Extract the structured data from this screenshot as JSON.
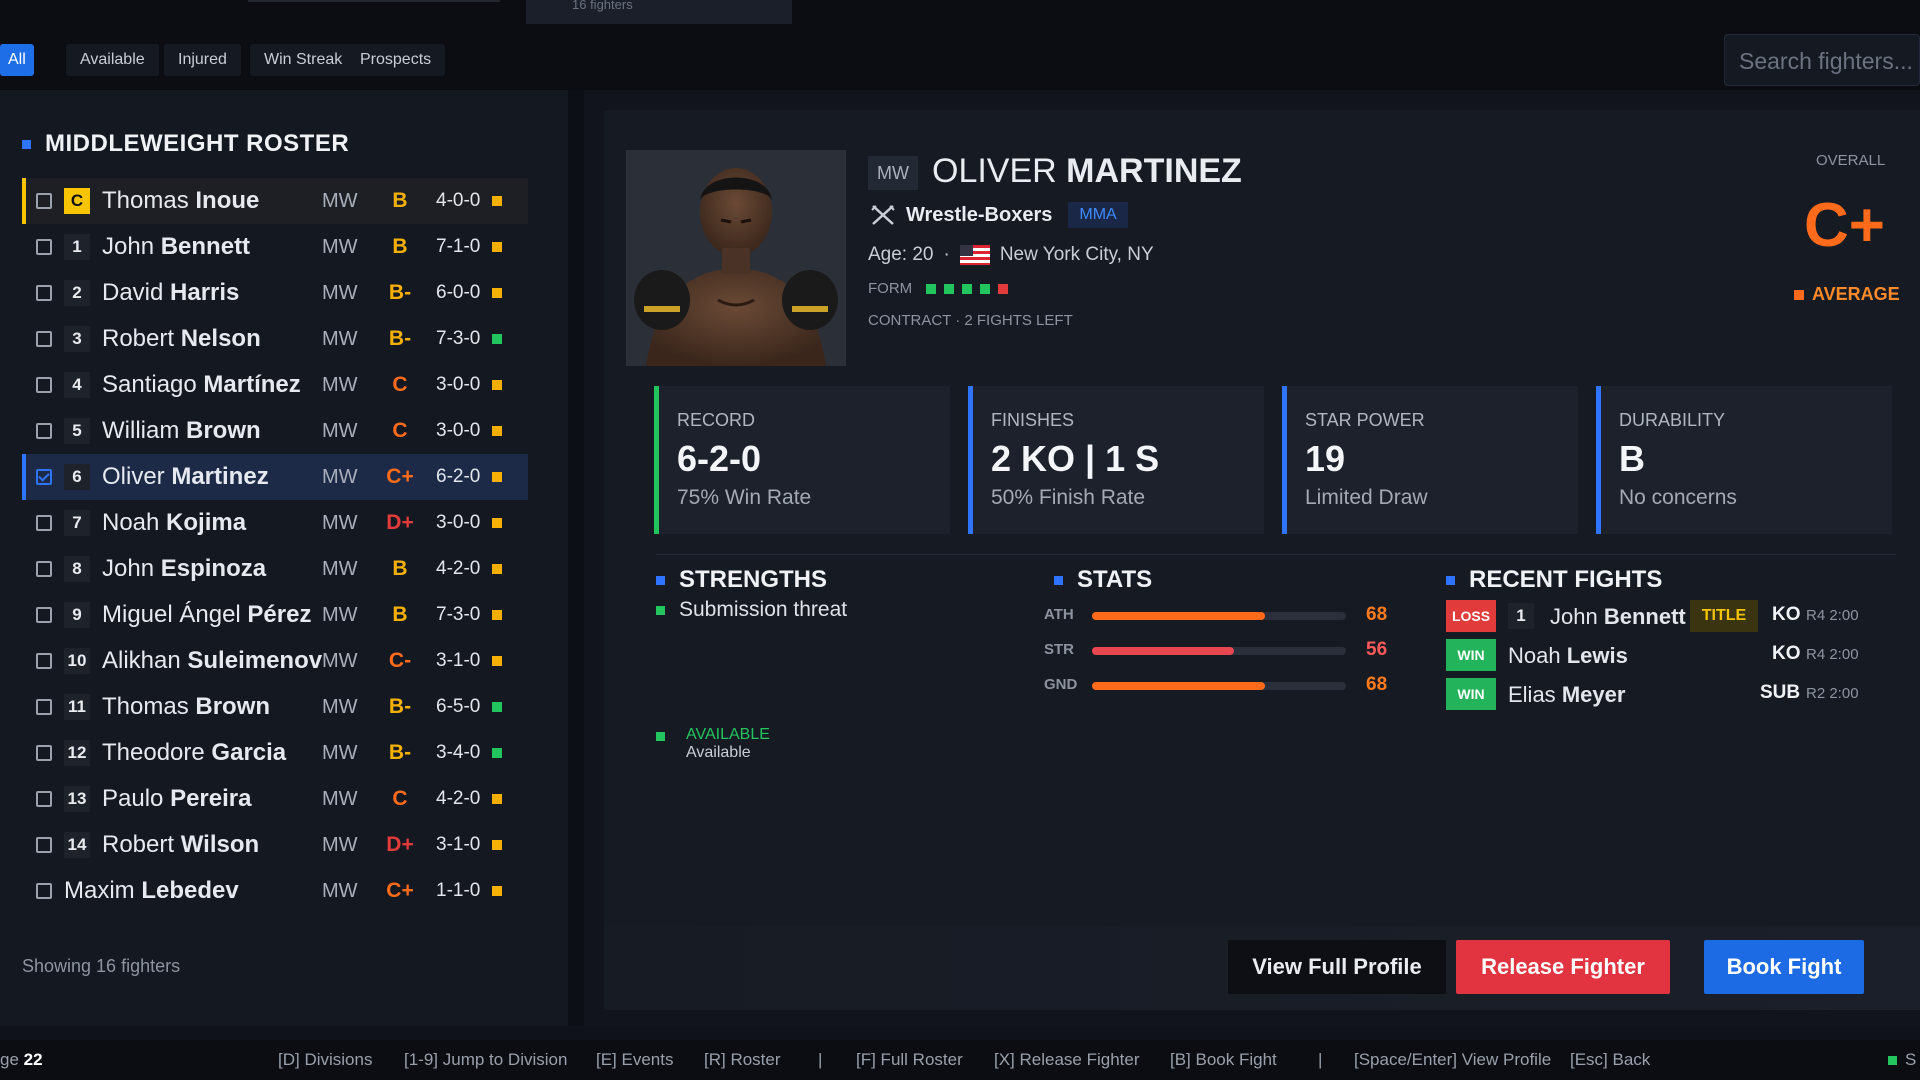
{
  "top": {
    "tab2_label": "16 fighters"
  },
  "filters": [
    {
      "label": "All",
      "active": true
    },
    {
      "label": "Available",
      "active": false
    },
    {
      "label": "Injured",
      "active": false
    },
    {
      "label": "Win Streak",
      "active": false
    },
    {
      "label": "Prospects",
      "active": false
    }
  ],
  "search": {
    "placeholder": "Search fighters..."
  },
  "roster": {
    "title": "MIDDLEWEIGHT ROSTER",
    "showing": "Showing 16 fighters",
    "fighters": [
      {
        "rank": "C",
        "first": "Thomas",
        "last": "Inoue",
        "wc": "MW",
        "grade": "B",
        "record": "4-0-0",
        "status": "orange"
      },
      {
        "rank": "1",
        "first": "John",
        "last": "Bennett",
        "wc": "MW",
        "grade": "B",
        "record": "7-1-0",
        "status": "orange"
      },
      {
        "rank": "2",
        "first": "David",
        "last": "Harris",
        "wc": "MW",
        "grade": "B-",
        "record": "6-0-0",
        "status": "orange"
      },
      {
        "rank": "3",
        "first": "Robert",
        "last": "Nelson",
        "wc": "MW",
        "grade": "B-",
        "record": "7-3-0",
        "status": "green"
      },
      {
        "rank": "4",
        "first": "Santiago",
        "last": "Martínez",
        "wc": "MW",
        "grade": "C",
        "record": "3-0-0",
        "status": "orange"
      },
      {
        "rank": "5",
        "first": "William",
        "last": "Brown",
        "wc": "MW",
        "grade": "C",
        "record": "3-0-0",
        "status": "orange"
      },
      {
        "rank": "6",
        "first": "Oliver",
        "last": "Martinez",
        "wc": "MW",
        "grade": "C+",
        "record": "6-2-0",
        "status": "orange"
      },
      {
        "rank": "7",
        "first": "Noah",
        "last": "Kojima",
        "wc": "MW",
        "grade": "D+",
        "record": "3-0-0",
        "status": "orange"
      },
      {
        "rank": "8",
        "first": "John",
        "last": "Espinoza",
        "wc": "MW",
        "grade": "B",
        "record": "4-2-0",
        "status": "orange"
      },
      {
        "rank": "9",
        "first": "Miguel Ángel",
        "last": "Pérez",
        "wc": "MW",
        "grade": "B",
        "record": "7-3-0",
        "status": "orange"
      },
      {
        "rank": "10",
        "first": "Alikhan",
        "last": "Suleimenov",
        "wc": "MW",
        "grade": "C-",
        "record": "3-1-0",
        "status": "orange"
      },
      {
        "rank": "11",
        "first": "Thomas",
        "last": "Brown",
        "wc": "MW",
        "grade": "B-",
        "record": "6-5-0",
        "status": "green"
      },
      {
        "rank": "12",
        "first": "Theodore",
        "last": "Garcia",
        "wc": "MW",
        "grade": "B-",
        "record": "3-4-0",
        "status": "green"
      },
      {
        "rank": "13",
        "first": "Paulo",
        "last": "Pereira",
        "wc": "MW",
        "grade": "C",
        "record": "4-2-0",
        "status": "orange"
      },
      {
        "rank": "14",
        "first": "Robert",
        "last": "Wilson",
        "wc": "MW",
        "grade": "D+",
        "record": "3-1-0",
        "status": "orange"
      },
      {
        "rank": "",
        "first": "Maxim",
        "last": "Lebedev",
        "wc": "MW",
        "grade": "C+",
        "record": "1-1-0",
        "status": "orange"
      }
    ]
  },
  "profile": {
    "wc": "MW",
    "first": "OLIVER",
    "last": "MARTINEZ",
    "style": "Wrestle-Boxers",
    "sport": "MMA",
    "age": "Age: 20",
    "location": "New York City, NY",
    "form_label": "FORM",
    "form": [
      "W",
      "W",
      "W",
      "W",
      "L"
    ],
    "contract": "CONTRACT · 2 FIGHTS LEFT",
    "overall_label": "OVERALL",
    "overall_grade": "C+",
    "overall_desc": "AVERAGE"
  },
  "cards": [
    {
      "label": "RECORD",
      "value": "6-2-0",
      "sub": "75% Win Rate"
    },
    {
      "label": "FINISHES",
      "value": "2 KO | 1 S",
      "sub": "50% Finish Rate"
    },
    {
      "label": "STAR POWER",
      "value": "19",
      "sub": "Limited Draw"
    },
    {
      "label": "DURABILITY",
      "value": "B",
      "sub": "No concerns"
    }
  ],
  "strengths": {
    "title": "STRENGTHS",
    "items": [
      "Submission threat"
    ]
  },
  "availability": {
    "status": "AVAILABLE",
    "label": "Available"
  },
  "stats": {
    "title": "STATS",
    "items": [
      {
        "label": "ATH",
        "value": 68
      },
      {
        "label": "STR",
        "value": 56
      },
      {
        "label": "GND",
        "value": 68
      }
    ]
  },
  "recent": {
    "title": "RECENT FIGHTS",
    "fights": [
      {
        "result": "LOSS",
        "rank": "1",
        "first": "John",
        "last": "Bennett",
        "tag": "TITLE",
        "method": "KO",
        "round": "R4 2:00"
      },
      {
        "result": "WIN",
        "rank": "",
        "first": "Noah",
        "last": "Lewis",
        "tag": "",
        "method": "KO",
        "round": "R4 2:00"
      },
      {
        "result": "WIN",
        "rank": "",
        "first": "Elias",
        "last": "Meyer",
        "tag": "",
        "method": "SUB",
        "round": "R2 2:00"
      }
    ]
  },
  "actions": {
    "view": "View Full Profile",
    "release": "Release Fighter",
    "book": "Book Fight"
  },
  "bottom": {
    "page_prefix": "ge",
    "page_num": "22",
    "hints": [
      "[D] Divisions",
      "[1-9] Jump to Division",
      "[E] Events",
      "[R] Roster",
      "|",
      "[F] Full Roster",
      "[X] Release Fighter",
      "[B] Book Fight",
      "|",
      "[Space/Enter] View Profile",
      "[Esc] Back"
    ],
    "right": "S"
  },
  "colors": {
    "accent": "#2f74ff",
    "orange": "#ff6b1a",
    "green": "#22c55e",
    "red": "#e23b3b",
    "gold": "#f6c500"
  }
}
